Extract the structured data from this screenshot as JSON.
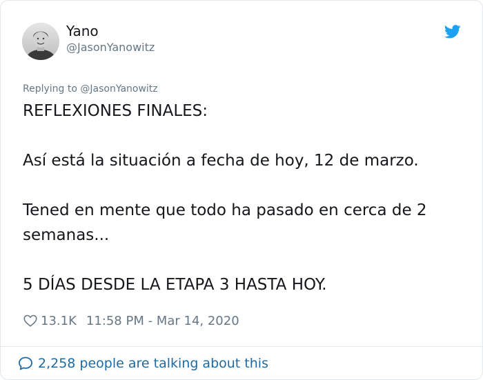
{
  "user": {
    "display_name": "Yano",
    "handle": "@JasonYanowitz"
  },
  "reply": {
    "text": "Replying to @JasonYanowitz"
  },
  "tweet": {
    "paragraphs": [
      "REFLEXIONES FINALES:",
      "Así está la situación a fecha de hoy, 12 de marzo.",
      "Tened en mente que todo ha pasado en cerca de 2 semanas...",
      "5 DÍAS DESDE LA ETAPA 3 HASTA HOY."
    ]
  },
  "meta": {
    "likes": "13.1K",
    "timestamp": "11:58 PM - Mar 14, 2020",
    "like_icon": "heart-icon"
  },
  "footer": {
    "talking": "2,258 people are talking about this",
    "talking_icon": "speech-bubble-icon"
  },
  "colors": {
    "twitter_blue": "#1da1f2",
    "link_blue": "#1b6aa5",
    "secondary_text": "#657786",
    "border": "#e1e8ed"
  }
}
